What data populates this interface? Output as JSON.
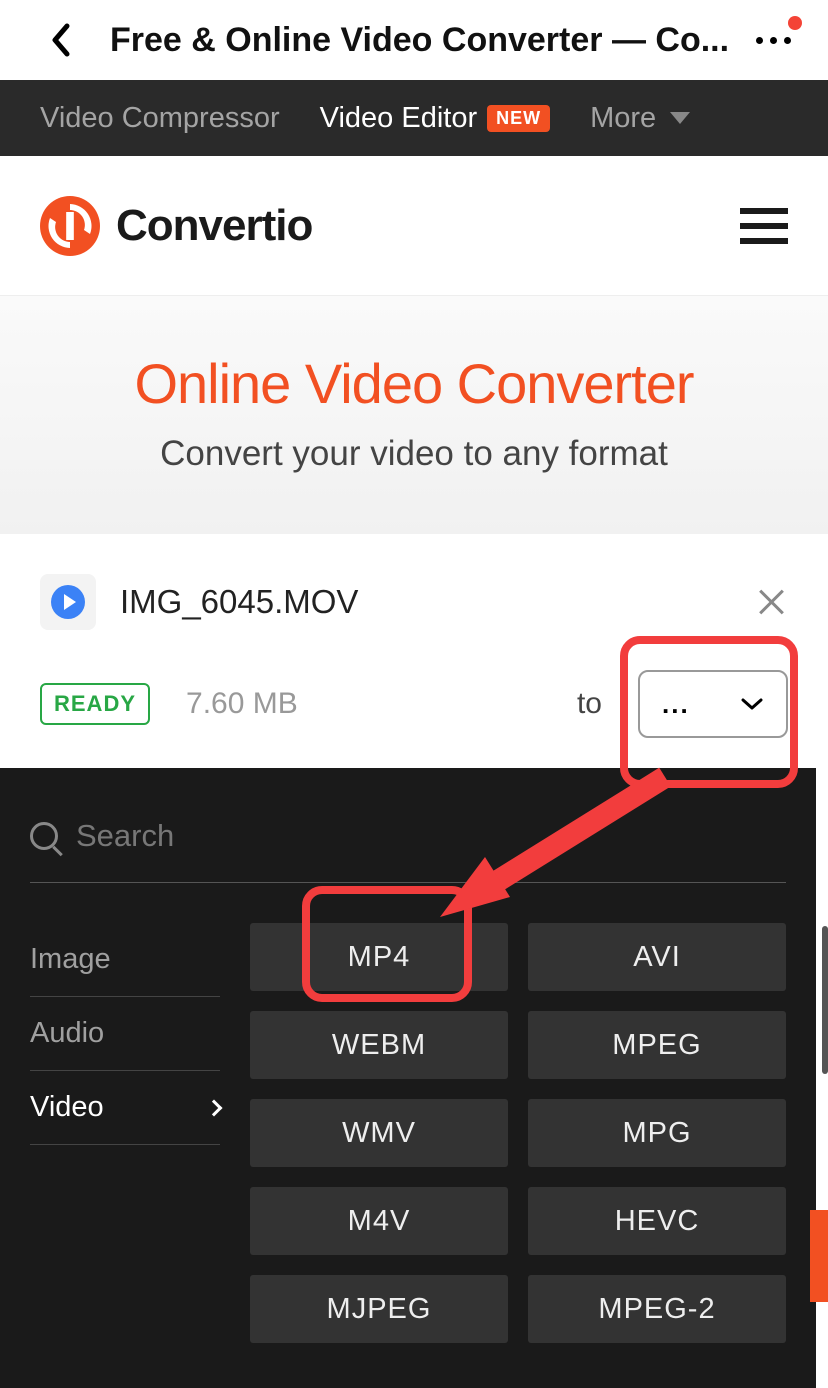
{
  "browser": {
    "title": "Free & Online Video Converter — Co..."
  },
  "darknav": {
    "compressor": "Video Compressor",
    "editor": "Video Editor",
    "new_badge": "NEW",
    "more": "More"
  },
  "brand": {
    "name": "Convertio"
  },
  "hero": {
    "title": "Online Video Converter",
    "subtitle": "Convert your video to any format"
  },
  "file": {
    "name": "IMG_6045.MOV",
    "status": "READY",
    "size": "7.60 MB",
    "to_label": "to",
    "format_display": "..."
  },
  "dropdown": {
    "search_placeholder": "Search",
    "categories": [
      {
        "label": "Image",
        "active": false
      },
      {
        "label": "Audio",
        "active": false
      },
      {
        "label": "Video",
        "active": true
      }
    ],
    "formats": [
      "MP4",
      "AVI",
      "WEBM",
      "MPEG",
      "WMV",
      "MPG",
      "M4V",
      "HEVC",
      "MJPEG",
      "MPEG-2"
    ]
  }
}
